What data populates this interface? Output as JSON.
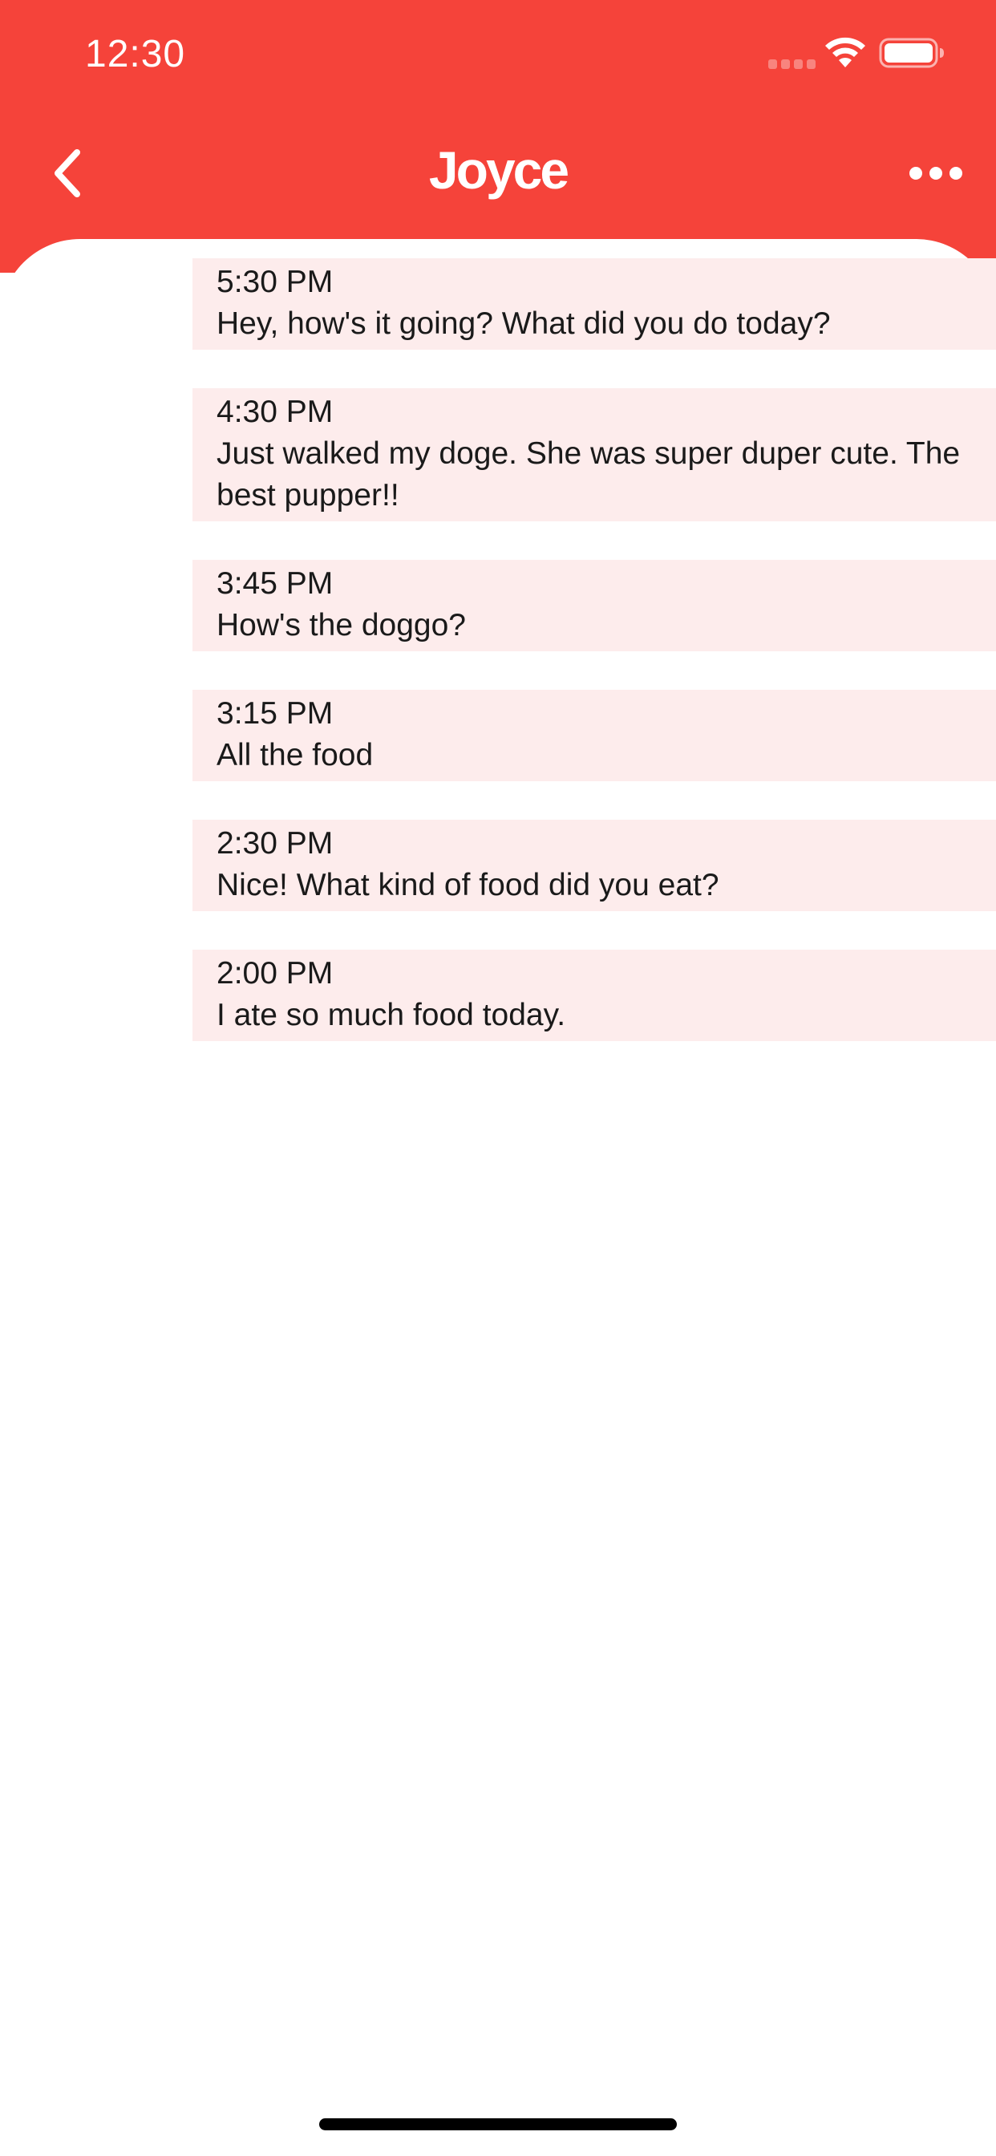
{
  "status_bar": {
    "time": "12:30"
  },
  "header": {
    "title": "Joyce",
    "back_icon": "chevron-left-icon",
    "more_icon": "ellipsis-icon"
  },
  "messages": [
    {
      "time": "5:30 PM",
      "text": "Hey, how's it going? What did you do today?"
    },
    {
      "time": "4:30 PM",
      "text": "Just walked my doge. She was super duper cute. The best pupper!!"
    },
    {
      "time": "3:45 PM",
      "text": "How's the doggo?"
    },
    {
      "time": "3:15 PM",
      "text": "All the food"
    },
    {
      "time": "2:30 PM",
      "text": "Nice! What kind of food did you eat?"
    },
    {
      "time": "2:00 PM",
      "text": "I ate so much food today."
    }
  ],
  "colors": {
    "header": "#f5433a",
    "bubble": "#fdecec",
    "text": "#1a1a1a"
  }
}
